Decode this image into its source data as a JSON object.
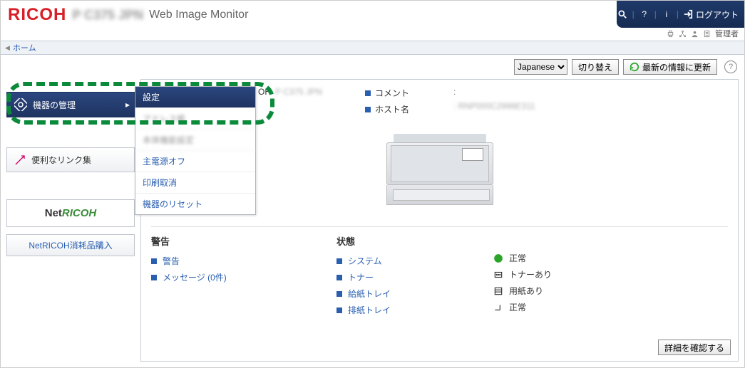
{
  "header": {
    "brand": "RICOH",
    "model": "P C375 JPN",
    "app_title": "Web Image Monitor",
    "logout": "ログアウト",
    "role": "管理者"
  },
  "nav": {
    "home": "ホーム"
  },
  "toolbar": {
    "language_selected": "Japanese",
    "switch_label": "切り替え",
    "refresh_label": "最新の情報に更新"
  },
  "sidebar": {
    "device_mgmt": "機器の管理",
    "useful_links": "便利なリンク集",
    "netricoh": "NetRICOH",
    "netricoh_buy": "NetRICOH消耗品購入"
  },
  "flyout": {
    "settings": "設定",
    "item2_obscured": "アドレス帳",
    "item3_obscured": "本体機能設定",
    "power_off": "主電源オフ",
    "cancel_print": "印刷取消",
    "device_reset": "機器のリセット"
  },
  "info": {
    "model_label": "OH",
    "model_value": "P C375 JPN",
    "comment_label": "コメント",
    "comment_value": ":",
    "host_label": "ホスト名",
    "host_value": ": RNP000C2998E311"
  },
  "panels": {
    "warnings": {
      "title": "警告",
      "items": [
        "警告",
        "メッセージ (0件)"
      ]
    },
    "status": {
      "title": "状態",
      "links": [
        "システム",
        "トナー",
        "給紙トレイ",
        "排紙トレイ"
      ],
      "values": [
        "正常",
        "トナーあり",
        "用紙あり",
        "正常"
      ]
    }
  },
  "footer": {
    "detail_button": "詳細を確認する"
  }
}
